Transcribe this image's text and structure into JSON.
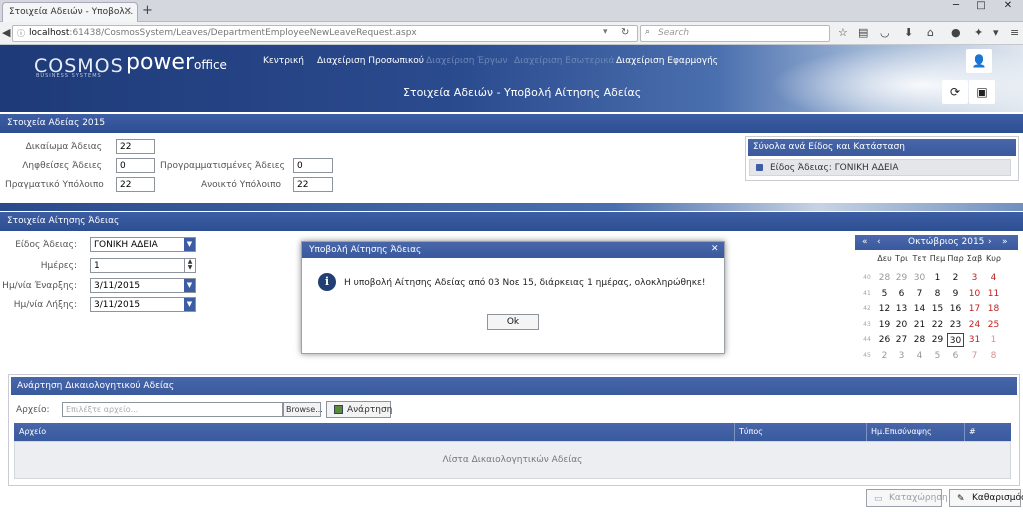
{
  "browser": {
    "tab_title": "Στοιχεία Αδειών - Υποβολ...",
    "url_host": "localhost",
    "url_path": ":61438/CosmosSystem/Leaves/DepartmentEmployeeNewLeaveRequest.aspx",
    "search_placeholder": "Search"
  },
  "header": {
    "logo_cosmos": "COSMOS",
    "logo_cosmos_sub": "BUSINESS SYSTEMS",
    "logo_power": "power",
    "logo_office": "office",
    "menu": [
      "Κεντρική",
      "Διαχείριση Προσωπικού",
      "Διαχείριση Έργων",
      "Διαχείριση Εσωτερικά",
      "Διαχείριση Εφαρμογής"
    ],
    "page_title": "Στοιχεία Αδειών - Υποβολή Αίτησης Αδείας"
  },
  "leave_info": {
    "section_title": "Στοιχεία Αδείας 2015",
    "entitlement_label": "Δικαίωμα Άδειας",
    "entitlement_value": "22",
    "taken_label": "Ληφθείσες Άδειες",
    "taken_value": "0",
    "scheduled_label": "Προγραμματισμένες Άδειες",
    "scheduled_value": "0",
    "actual_balance_label": "Πραγματικό Υπόλοιπο",
    "actual_balance_value": "22",
    "open_balance_label": "Ανοικτό Υπόλοιπο",
    "open_balance_value": "22"
  },
  "totals": {
    "title": "Σύνολα ανά Είδος και Κατάσταση",
    "row": "Είδος Άδειας: ΓΟΝΙΚΗ ΑΔΕΙΑ"
  },
  "request": {
    "section_title": "Στοιχεία Αίτησης Άδειας",
    "type_label": "Είδος Άδειας:",
    "type_value": "ΓΟΝΙΚΗ ΑΔΕΙΑ",
    "days_label": "Ημέρες:",
    "days_value": "1",
    "start_label": "Ημ/νία Έναρξης:",
    "start_value": "3/11/2015",
    "end_label": "Ημ/νία Λήξης:",
    "end_value": "3/11/2015"
  },
  "calendar": {
    "month_label": "Οκτώβριος 2015",
    "weekdays": [
      "Δευ",
      "Τρι",
      "Τετ",
      "Πεμ",
      "Παρ",
      "Σαβ",
      "Κυρ"
    ],
    "weeks": [
      {
        "no": "40",
        "days": [
          "28",
          "29",
          "30",
          "1",
          "2",
          "3",
          "4"
        ]
      },
      {
        "no": "41",
        "days": [
          "5",
          "6",
          "7",
          "8",
          "9",
          "10",
          "11"
        ]
      },
      {
        "no": "42",
        "days": [
          "12",
          "13",
          "14",
          "15",
          "16",
          "17",
          "18"
        ]
      },
      {
        "no": "43",
        "days": [
          "19",
          "20",
          "21",
          "22",
          "23",
          "24",
          "25"
        ]
      },
      {
        "no": "44",
        "days": [
          "26",
          "27",
          "28",
          "29",
          "30",
          "31",
          "1"
        ]
      },
      {
        "no": "45",
        "days": [
          "2",
          "3",
          "4",
          "5",
          "6",
          "7",
          "8"
        ]
      }
    ],
    "today": "30"
  },
  "modal": {
    "title": "Υποβολή Αίτησης Άδειας",
    "message": "Η υποβολή Αίτησης Αδείας από 03 Νοε 15, διάρκειας 1 ημέρας, ολοκληρώθηκε!",
    "ok_label": "Ok"
  },
  "upload": {
    "section_title": "Ανάρτηση Δικαιολογητικού Αδείας",
    "file_label": "Αρχείο:",
    "file_placeholder": "Επιλέξτε αρχείο...",
    "browse_label": "Browse...",
    "upload_label": "Ανάρτηση",
    "columns": [
      "Αρχείο",
      "Τύπος",
      "Ημ.Επισύναψης",
      "#"
    ],
    "empty_text": "Λίστα Δικαιολογητικών Αδείας"
  },
  "footer": {
    "submit_label": "Καταχώρηση",
    "clear_label": "Καθαρισμός"
  }
}
